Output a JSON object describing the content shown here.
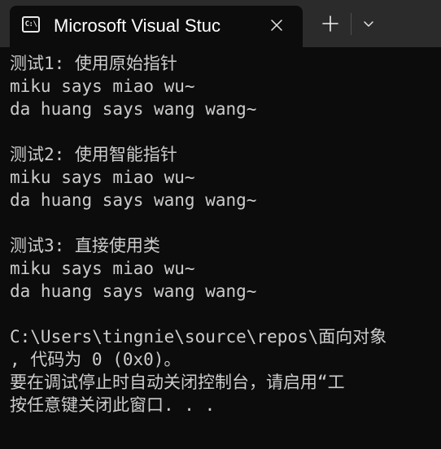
{
  "tab": {
    "icon_text": "C:\\",
    "title": "Microsoft Visual Stuc",
    "close_icon": "close-icon",
    "new_tab_icon": "plus-icon",
    "dropdown_icon": "chevron-down-icon"
  },
  "console": {
    "lines": [
      "测试1: 使用原始指针",
      "miku says miao wu~",
      "da huang says wang wang~",
      "",
      "测试2: 使用智能指针",
      "miku says miao wu~",
      "da huang says wang wang~",
      "",
      "测试3: 直接使用类",
      "miku says miao wu~",
      "da huang says wang wang~",
      "",
      "C:\\Users\\tingnie\\source\\repos\\面向对象",
      ", 代码为 0 (0x0)。",
      "要在调试停止时自动关闭控制台，请启用“工",
      "按任意键关闭此窗口. . ."
    ]
  },
  "colors": {
    "background": "#0c0c0c",
    "titlebar": "#2b2b2b",
    "text": "#cccccc"
  }
}
